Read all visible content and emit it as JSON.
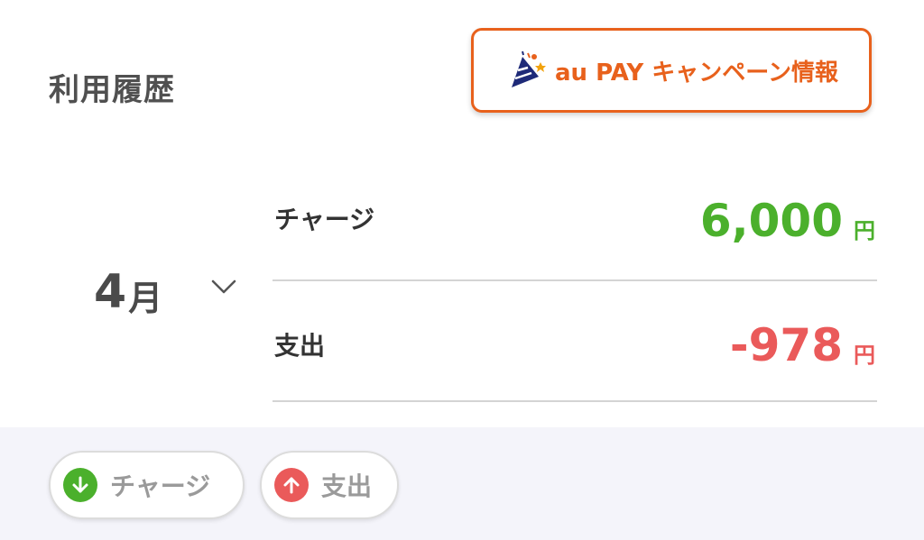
{
  "header": {
    "title": "利用履歴",
    "campaign_button": {
      "label": "au PAY キャンペーン情報",
      "icon": "party-popper-icon",
      "color": "#e8611c"
    }
  },
  "month_selector": {
    "number": "4",
    "unit": "月",
    "icon": "chevron-down-icon"
  },
  "summary": {
    "charge": {
      "label": "チャージ",
      "amount": "6,000",
      "unit": "円",
      "color": "#4bb02c"
    },
    "expense": {
      "label": "支出",
      "amount": "-978",
      "unit": "円",
      "color": "#ea5a5a"
    }
  },
  "filters": [
    {
      "label": "チャージ",
      "icon": "arrow-down-icon",
      "color": "#4bb02c"
    },
    {
      "label": "支出",
      "icon": "arrow-up-icon",
      "color": "#ea5a5a"
    }
  ]
}
